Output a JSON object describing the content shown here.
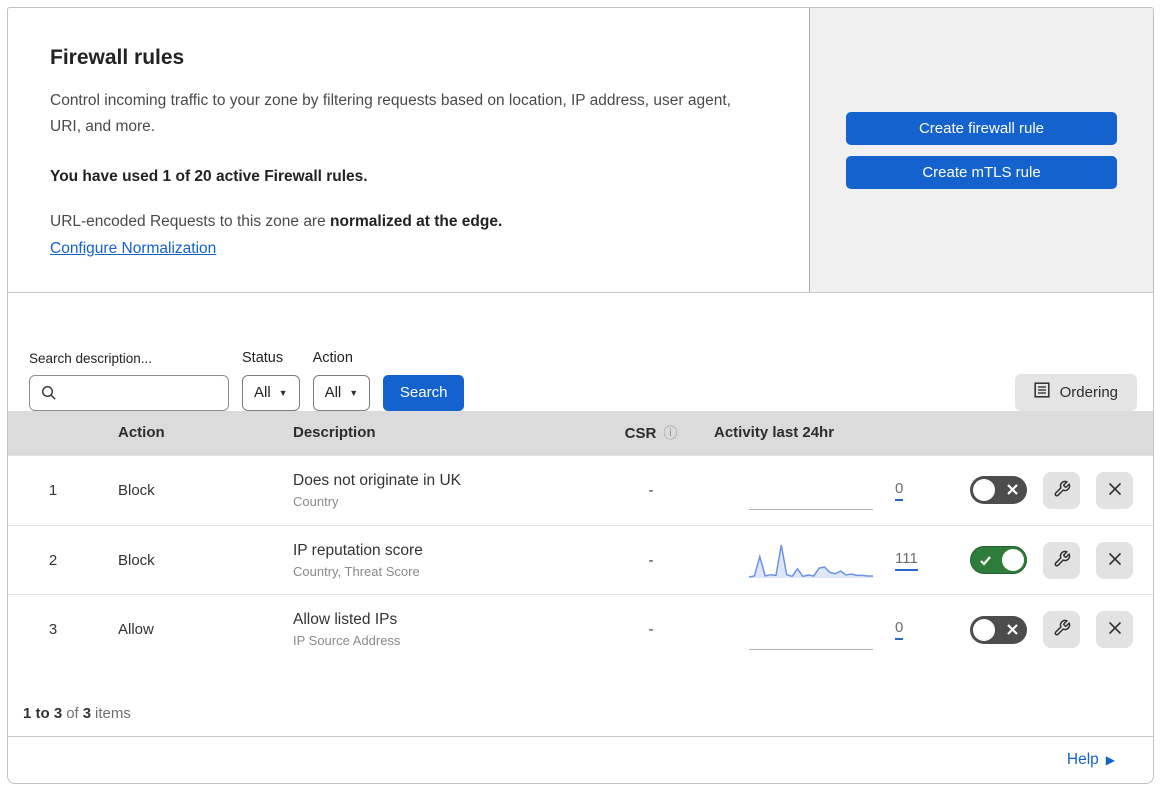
{
  "header": {
    "title": "Firewall rules",
    "description": "Control incoming traffic to your zone by filtering requests based on location, IP address, user agent, URI, and more.",
    "usage_text": "You have used 1 of 20 active Firewall rules.",
    "normalization_prefix": "URL-encoded Requests to this zone are ",
    "normalization_bold": "normalized at the edge.",
    "normalization_link": "Configure Normalization",
    "create_firewall_rule_label": "Create firewall rule",
    "create_mtls_rule_label": "Create mTLS rule"
  },
  "filters": {
    "search_label": "Search description...",
    "status_label": "Status",
    "status_value": "All",
    "action_label": "Action",
    "action_value": "All",
    "search_button_label": "Search",
    "ordering_button_label": "Ordering"
  },
  "table": {
    "columns": {
      "action": "Action",
      "description": "Description",
      "csr": "CSR",
      "activity": "Activity last 24hr"
    },
    "rows": [
      {
        "num": "1",
        "action": "Block",
        "description": "Does not originate in UK",
        "fields": "Country",
        "csr": "-",
        "activity_count": "0",
        "enabled": false
      },
      {
        "num": "2",
        "action": "Block",
        "description": "IP reputation score",
        "fields": "Country, Threat Score",
        "csr": "-",
        "activity_count": "111",
        "enabled": true,
        "sparkline": [
          3,
          6,
          65,
          6,
          10,
          8,
          100,
          10,
          5,
          28,
          5,
          9,
          6,
          30,
          33,
          17,
          13,
          21,
          9,
          12,
          8,
          8,
          6,
          6
        ]
      },
      {
        "num": "3",
        "action": "Allow",
        "description": "Allow listed IPs",
        "fields": "IP Source Address",
        "csr": "-",
        "activity_count": "0",
        "enabled": false
      }
    ]
  },
  "footer": {
    "range_text": "1 to 3",
    "of_text": "of",
    "total_text": "3",
    "items_text": "items"
  },
  "help": {
    "label": "Help"
  },
  "colors": {
    "accent_blue": "#1462cd",
    "link_blue": "#1462cd",
    "toggle_on_green": "#2d7c3c",
    "toggle_off_gray": "#4d4d4d",
    "sparkline_line": "#6d92e3",
    "sparkline_fill": "#dde7f8",
    "count_underline_blue": "#2766c2",
    "panel_gray": "#f0f0f0",
    "table_header_gray": "#dbdbdb"
  }
}
